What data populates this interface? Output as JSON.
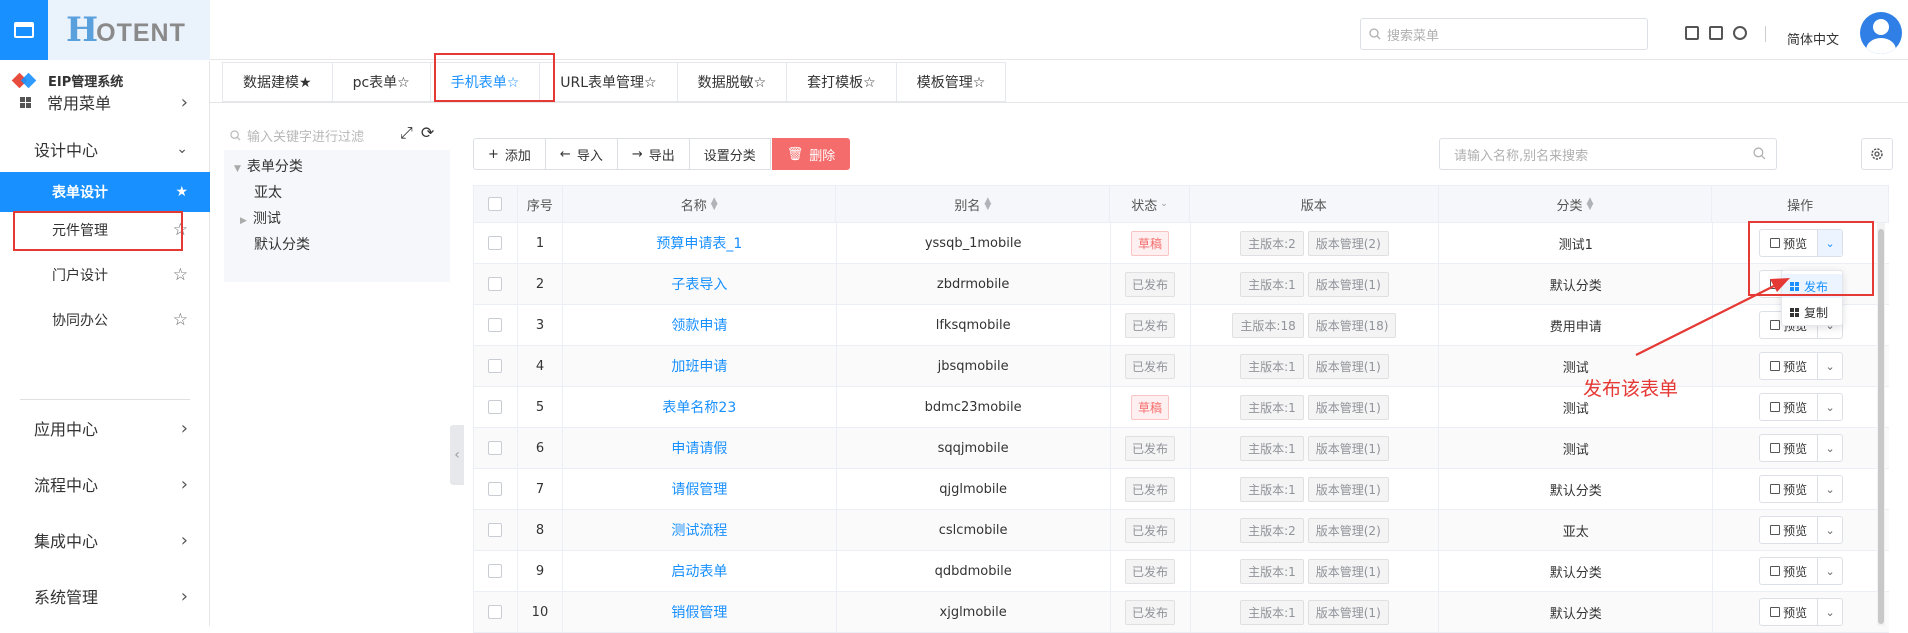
{
  "header": {
    "logo_h": "H",
    "logo_rest": "OTENT",
    "search_placeholder": "搜索菜单",
    "language": "简体中文"
  },
  "sidebar": {
    "system_title": "EIP管理系统",
    "items": [
      {
        "label": "常用菜单"
      },
      {
        "label": "设计中心"
      },
      {
        "label": "表单设计"
      },
      {
        "label": "元件管理"
      },
      {
        "label": "门户设计"
      },
      {
        "label": "协同办公"
      },
      {
        "label": "应用中心"
      },
      {
        "label": "流程中心"
      },
      {
        "label": "集成中心"
      },
      {
        "label": "系统管理"
      }
    ]
  },
  "tabs": [
    {
      "label": "数据建模★"
    },
    {
      "label": "pc表单☆"
    },
    {
      "label": "手机表单☆",
      "active": true
    },
    {
      "label": "URL表单管理☆"
    },
    {
      "label": "数据脱敏☆"
    },
    {
      "label": "套打模板☆"
    },
    {
      "label": "模板管理☆"
    }
  ],
  "tree": {
    "search_placeholder": "输入关键字进行过滤",
    "nodes": [
      {
        "label": "表单分类"
      },
      {
        "label": "亚太"
      },
      {
        "label": "测试"
      },
      {
        "label": "默认分类"
      }
    ]
  },
  "toolbar": {
    "add": "添加",
    "import": "导入",
    "export": "导出",
    "set_category": "设置分类",
    "delete": "删除",
    "search_placeholder": "请输入名称,别名来搜索"
  },
  "table": {
    "headers": {
      "no": "序号",
      "name": "名称",
      "alias": "别名",
      "status": "状态",
      "version": "版本",
      "category": "分类",
      "ops": "操作"
    },
    "rows": [
      {
        "no": "1",
        "name": "预算申请表_1",
        "alias": "yssqb_1mobile",
        "status": "草稿",
        "main": "主版本:2",
        "mgr": "版本管理(2)",
        "category": "测试1"
      },
      {
        "no": "2",
        "name": "子表导入",
        "alias": "zbdrmobile",
        "status": "已发布",
        "main": "主版本:1",
        "mgr": "版本管理(1)",
        "category": "默认分类"
      },
      {
        "no": "3",
        "name": "领款申请",
        "alias": "lfksqmobile",
        "status": "已发布",
        "main": "主版本:18",
        "mgr": "版本管理(18)",
        "category": "费用申请"
      },
      {
        "no": "4",
        "name": "加班申请",
        "alias": "jbsqmobile",
        "status": "已发布",
        "main": "主版本:1",
        "mgr": "版本管理(1)",
        "category": "测试"
      },
      {
        "no": "5",
        "name": "表单名称23",
        "alias": "bdmc23mobile",
        "status": "草稿",
        "main": "主版本:1",
        "mgr": "版本管理(1)",
        "category": "测试"
      },
      {
        "no": "6",
        "name": "申请请假",
        "alias": "sqqjmobile",
        "status": "已发布",
        "main": "主版本:1",
        "mgr": "版本管理(1)",
        "category": "测试"
      },
      {
        "no": "7",
        "name": "请假管理",
        "alias": "qjglmobile",
        "status": "已发布",
        "main": "主版本:1",
        "mgr": "版本管理(1)",
        "category": "默认分类"
      },
      {
        "no": "8",
        "name": "测试流程",
        "alias": "cslcmobile",
        "status": "已发布",
        "main": "主版本:2",
        "mgr": "版本管理(2)",
        "category": "亚太"
      },
      {
        "no": "9",
        "name": "启动表单",
        "alias": "qdbdmobile",
        "status": "已发布",
        "main": "主版本:1",
        "mgr": "版本管理(1)",
        "category": "默认分类"
      },
      {
        "no": "10",
        "name": "销假管理",
        "alias": "xjglmobile",
        "status": "已发布",
        "main": "主版本:1",
        "mgr": "版本管理(1)",
        "category": "默认分类"
      }
    ],
    "preview_label": "预览"
  },
  "dropdown": {
    "publish": "发布",
    "copy": "复制"
  },
  "annotation": {
    "text": "发布该表单"
  },
  "colors": {
    "primary": "#1890ff",
    "danger": "#f56c6c",
    "annotation": "#e53935"
  }
}
